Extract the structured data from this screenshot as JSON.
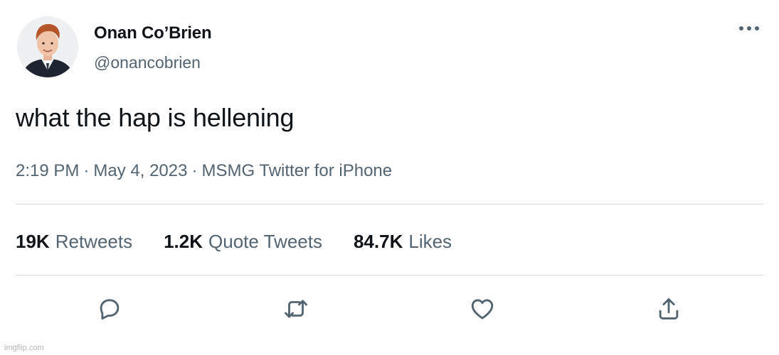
{
  "author": {
    "display_name": "Onan Co’Brien",
    "handle": "@onancobrien"
  },
  "tweet": {
    "text": "what the hap is hellening",
    "time": "2:19 PM",
    "date": "May 4, 2023",
    "source": "MSMG Twitter for iPhone",
    "separator": "·"
  },
  "stats": [
    {
      "count": "19K",
      "label": "Retweets"
    },
    {
      "count": "1.2K",
      "label": "Quote Tweets"
    },
    {
      "count": "84.7K",
      "label": "Likes"
    }
  ],
  "actions": [
    {
      "icon": "reply-icon"
    },
    {
      "icon": "retweet-icon"
    },
    {
      "icon": "like-icon"
    },
    {
      "icon": "share-icon"
    }
  ],
  "menu_icon": "more-options-icon",
  "watermark": "imgflip.com",
  "colors": {
    "text_primary": "#0f1419",
    "text_secondary": "#536471",
    "divider": "#cfd9de",
    "icon": "#536471"
  }
}
